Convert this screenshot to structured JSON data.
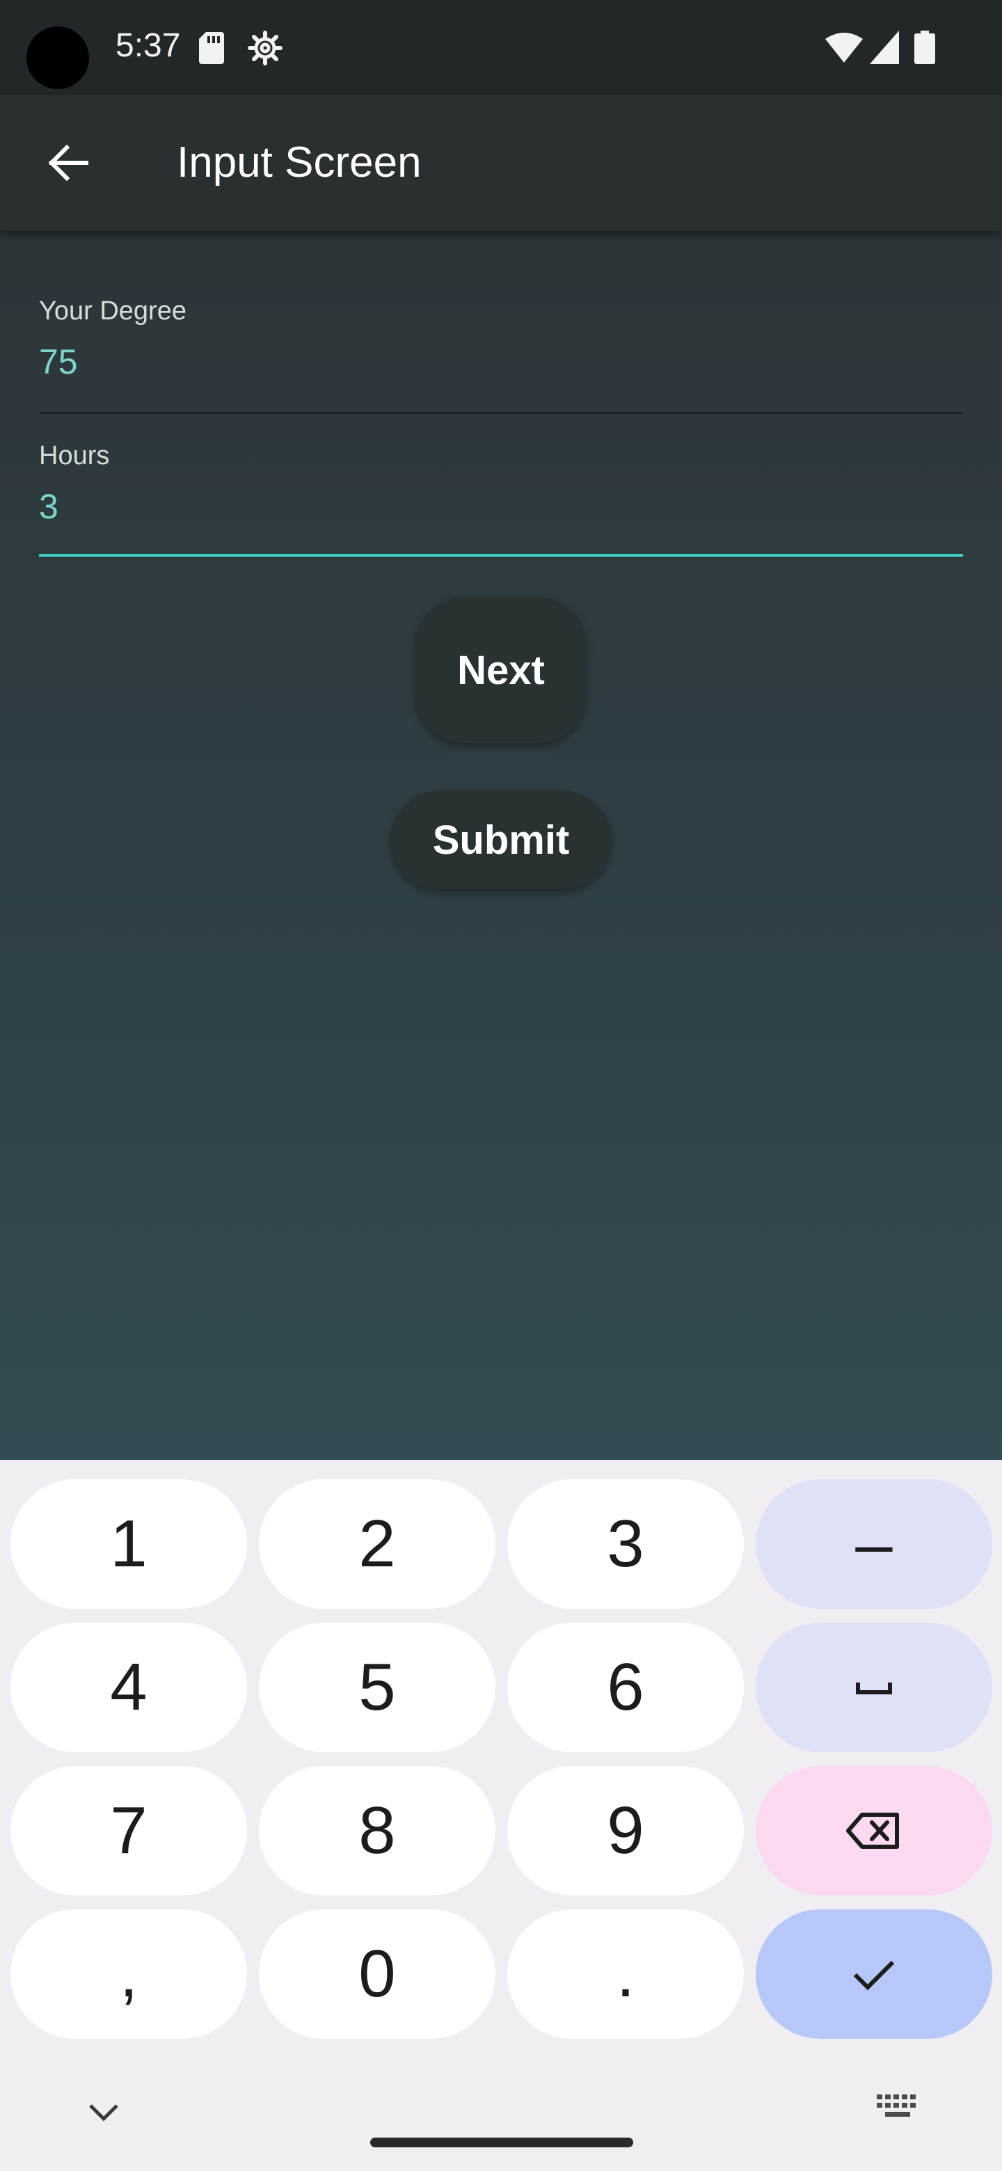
{
  "status_bar": {
    "time": "5:37",
    "icons": [
      "sd-card-icon",
      "settings-gear-icon",
      "wifi-icon",
      "cell-signal-icon",
      "battery-icon"
    ]
  },
  "app_bar": {
    "title": "Input Screen",
    "back_icon": "arrow-back-icon"
  },
  "form": {
    "degree": {
      "label": "Your Degree",
      "value": "75"
    },
    "hours": {
      "label": "Hours",
      "value": "3"
    },
    "next_label": "Next",
    "submit_label": "Submit"
  },
  "keyboard": {
    "rows": [
      [
        "1",
        "2",
        "3",
        "–"
      ],
      [
        "4",
        "5",
        "6",
        "space"
      ],
      [
        "7",
        "8",
        "9",
        "backspace"
      ],
      [
        ",",
        "0",
        ".",
        "done"
      ]
    ],
    "key_1": "1",
    "key_2": "2",
    "key_3": "3",
    "key_dash": "–",
    "key_4": "4",
    "key_5": "5",
    "key_6": "6",
    "key_7": "7",
    "key_8": "8",
    "key_9": "9",
    "key_comma": ",",
    "key_0": "0",
    "key_period": "."
  },
  "colors": {
    "accent": "#3fd0c4",
    "input_text": "#7fd3cf",
    "function_key": "#dfe1f6",
    "delete_key": "#fbd9f1",
    "enter_key": "#b7c7f8"
  }
}
